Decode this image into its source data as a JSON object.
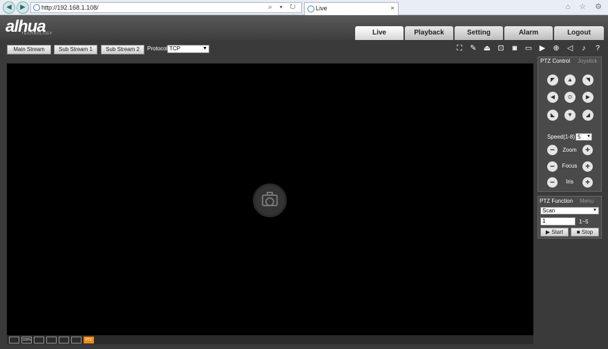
{
  "browser": {
    "address": "http://192.168.1.108/",
    "address_icons": "⌕ ▾ ↻",
    "tab_title": "Live",
    "tab_close": "×",
    "window_icons": "⌂ ☆ ⚙",
    "back_icon": "back-icon",
    "forward_icon": "forward-icon"
  },
  "header": {
    "logo_text": "alhua",
    "logo_sub": "TECHNOLOGY",
    "tabs": [
      {
        "label": "Live"
      },
      {
        "label": "Playback"
      },
      {
        "label": "Setting"
      },
      {
        "label": "Alarm"
      },
      {
        "label": "Logout"
      }
    ]
  },
  "toolbar": {
    "main_stream": "Main Stream",
    "sub_stream_1": "Sub Stream 1",
    "sub_stream_2": "Sub Stream 2",
    "protocol_label": "Protocol",
    "protocol_value": "TCP",
    "icons": [
      "fullscreen-icon",
      "pen-icon",
      "alarm-icon",
      "snapshot-icon",
      "record-dot-icon",
      "card-icon",
      "video-record-icon",
      "target-icon",
      "audio-icon",
      "microphone-icon",
      "help-icon"
    ]
  },
  "ptz": {
    "tab_control": "PTZ Control",
    "tab_joystick": "Joystick",
    "speed_label": "Speed(1-8):",
    "speed_value": "5",
    "zoom_label": "Zoom",
    "focus_label": "Focus",
    "iris_label": "Iris",
    "minus": "−",
    "plus": "+"
  },
  "ptz_function": {
    "title": "PTZ Function",
    "menu": "Menu",
    "select_value": "Scan",
    "input_value": "1",
    "range": "1~5",
    "start": "▶ Start",
    "stop": "■ Stop"
  },
  "bottom_bar": {
    "items": [
      "",
      "100%",
      "",
      "",
      "",
      "",
      "PTZ"
    ]
  }
}
